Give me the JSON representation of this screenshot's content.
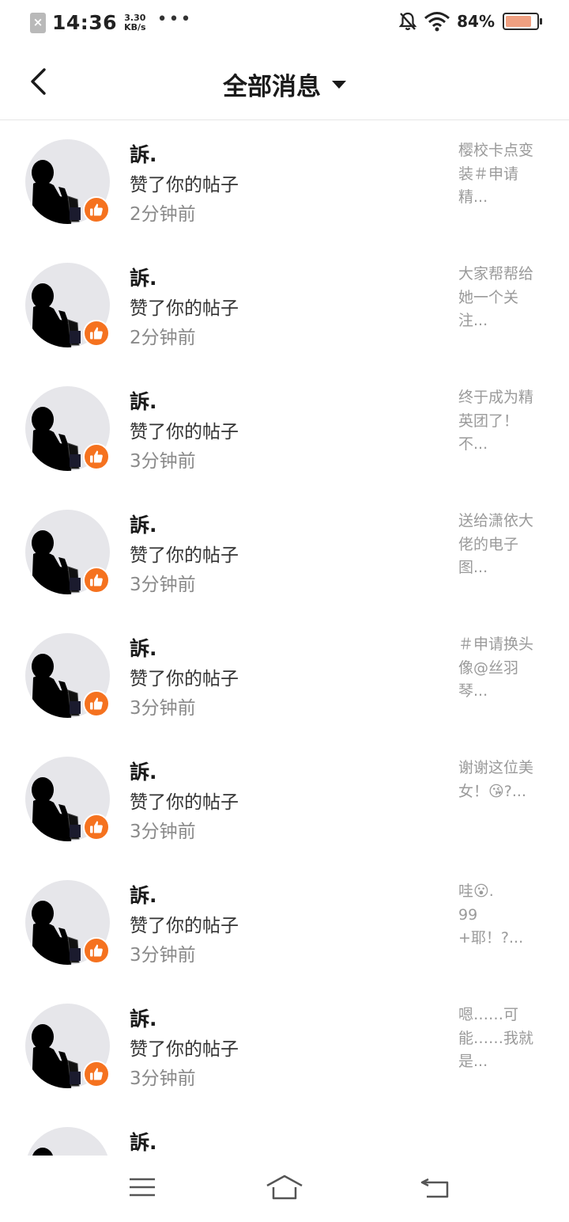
{
  "status_bar": {
    "time": "14:36",
    "speed_value": "3.30",
    "speed_unit": "KB/s",
    "dots": "•••",
    "battery_percent": "84%",
    "battery_level": 0.84
  },
  "header": {
    "title": "全部消息"
  },
  "notifications": [
    {
      "name": "訴.",
      "action": "赞了你的帖子",
      "time": "2分钟前",
      "preview": "樱校卡点变装＃申请精..."
    },
    {
      "name": "訴.",
      "action": "赞了你的帖子",
      "time": "2分钟前",
      "preview": "大家帮帮给她一个关注..."
    },
    {
      "name": "訴.",
      "action": "赞了你的帖子",
      "time": "3分钟前",
      "preview": "终于成为精英团了！不..."
    },
    {
      "name": "訴.",
      "action": "赞了你的帖子",
      "time": "3分钟前",
      "preview": "送给潇依大佬的电子图..."
    },
    {
      "name": "訴.",
      "action": "赞了你的帖子",
      "time": "3分钟前",
      "preview": "＃申请换头像@丝羽琴..."
    },
    {
      "name": "訴.",
      "action": "赞了你的帖子",
      "time": "3分钟前",
      "preview": "谢谢这位美女！😘?..."
    },
    {
      "name": "訴.",
      "action": "赞了你的帖子",
      "time": "3分钟前",
      "preview": "哇😮.\n99+耶！?..."
    },
    {
      "name": "訴.",
      "action": "赞了你的帖子",
      "time": "3分钟前",
      "preview": "嗯……可能……我就是..."
    },
    {
      "name": "訴.",
      "action": "",
      "time": "",
      "preview": ""
    }
  ],
  "colors": {
    "like_badge": "#f5721f",
    "avatar_bg": "#e6e6ea",
    "battery_fill": "#f0a081"
  }
}
